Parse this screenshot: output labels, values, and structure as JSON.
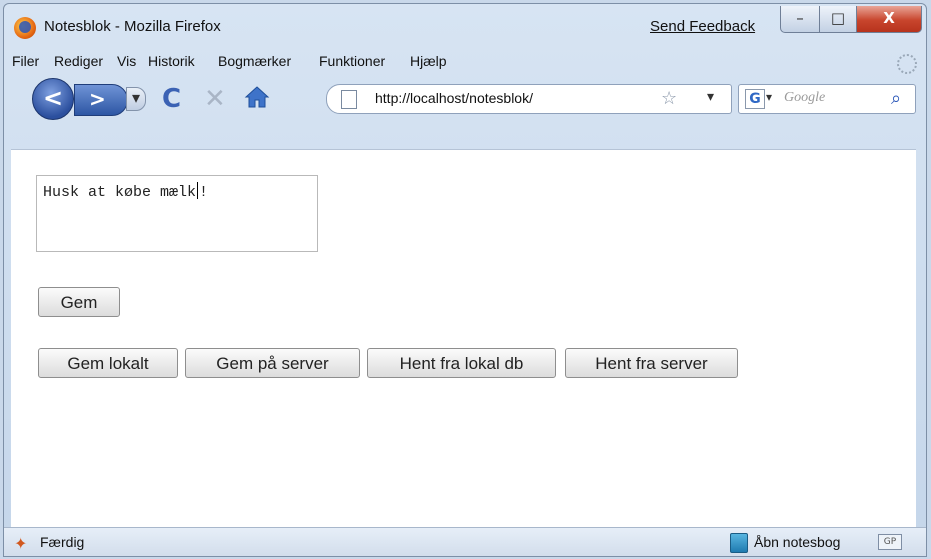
{
  "window": {
    "title": "Notesblok - Mozilla Firefox",
    "feedback_link": "Send Feedback",
    "buttons": {
      "minimize": "–",
      "maximize": "□",
      "close": "X"
    }
  },
  "menubar": {
    "items": [
      "Filer",
      "Rediger",
      "Vis",
      "Historik",
      "Bogmærker",
      "Funktioner",
      "Hjælp"
    ]
  },
  "navbar": {
    "url": "http://localhost/notesblok/",
    "search_placeholder": "Google",
    "search_engine_icon": "G",
    "back_glyph": "<",
    "forward_glyph": ">",
    "reload_glyph": "C",
    "stop_glyph": "✕",
    "bookmark_star_glyph": "☆",
    "search_glyph": "⌕"
  },
  "page": {
    "note_text_before_cursor": "Husk at købe mælk",
    "note_text_after_cursor": "!",
    "save_button": "Gem",
    "buttons": [
      "Gem lokalt",
      "Gem på server",
      "Hent fra lokal db",
      "Hent fra server"
    ]
  },
  "statusbar": {
    "status": "Færdig",
    "notebook_link": "Åbn notesbog",
    "addon_badge": "GP"
  },
  "colors": {
    "window_frame": "#c5d6ea",
    "close_button": "#c8452d",
    "accent": "#2b4f9e"
  },
  "icons": [
    "firefox-app-icon",
    "back-arrow-icon",
    "forward-arrow-icon",
    "reload-icon",
    "stop-icon",
    "home-icon",
    "page-icon",
    "bookmark-star-icon",
    "google-icon",
    "search-magnifier-icon",
    "status-icon",
    "notebook-icon",
    "throbber-icon"
  ]
}
